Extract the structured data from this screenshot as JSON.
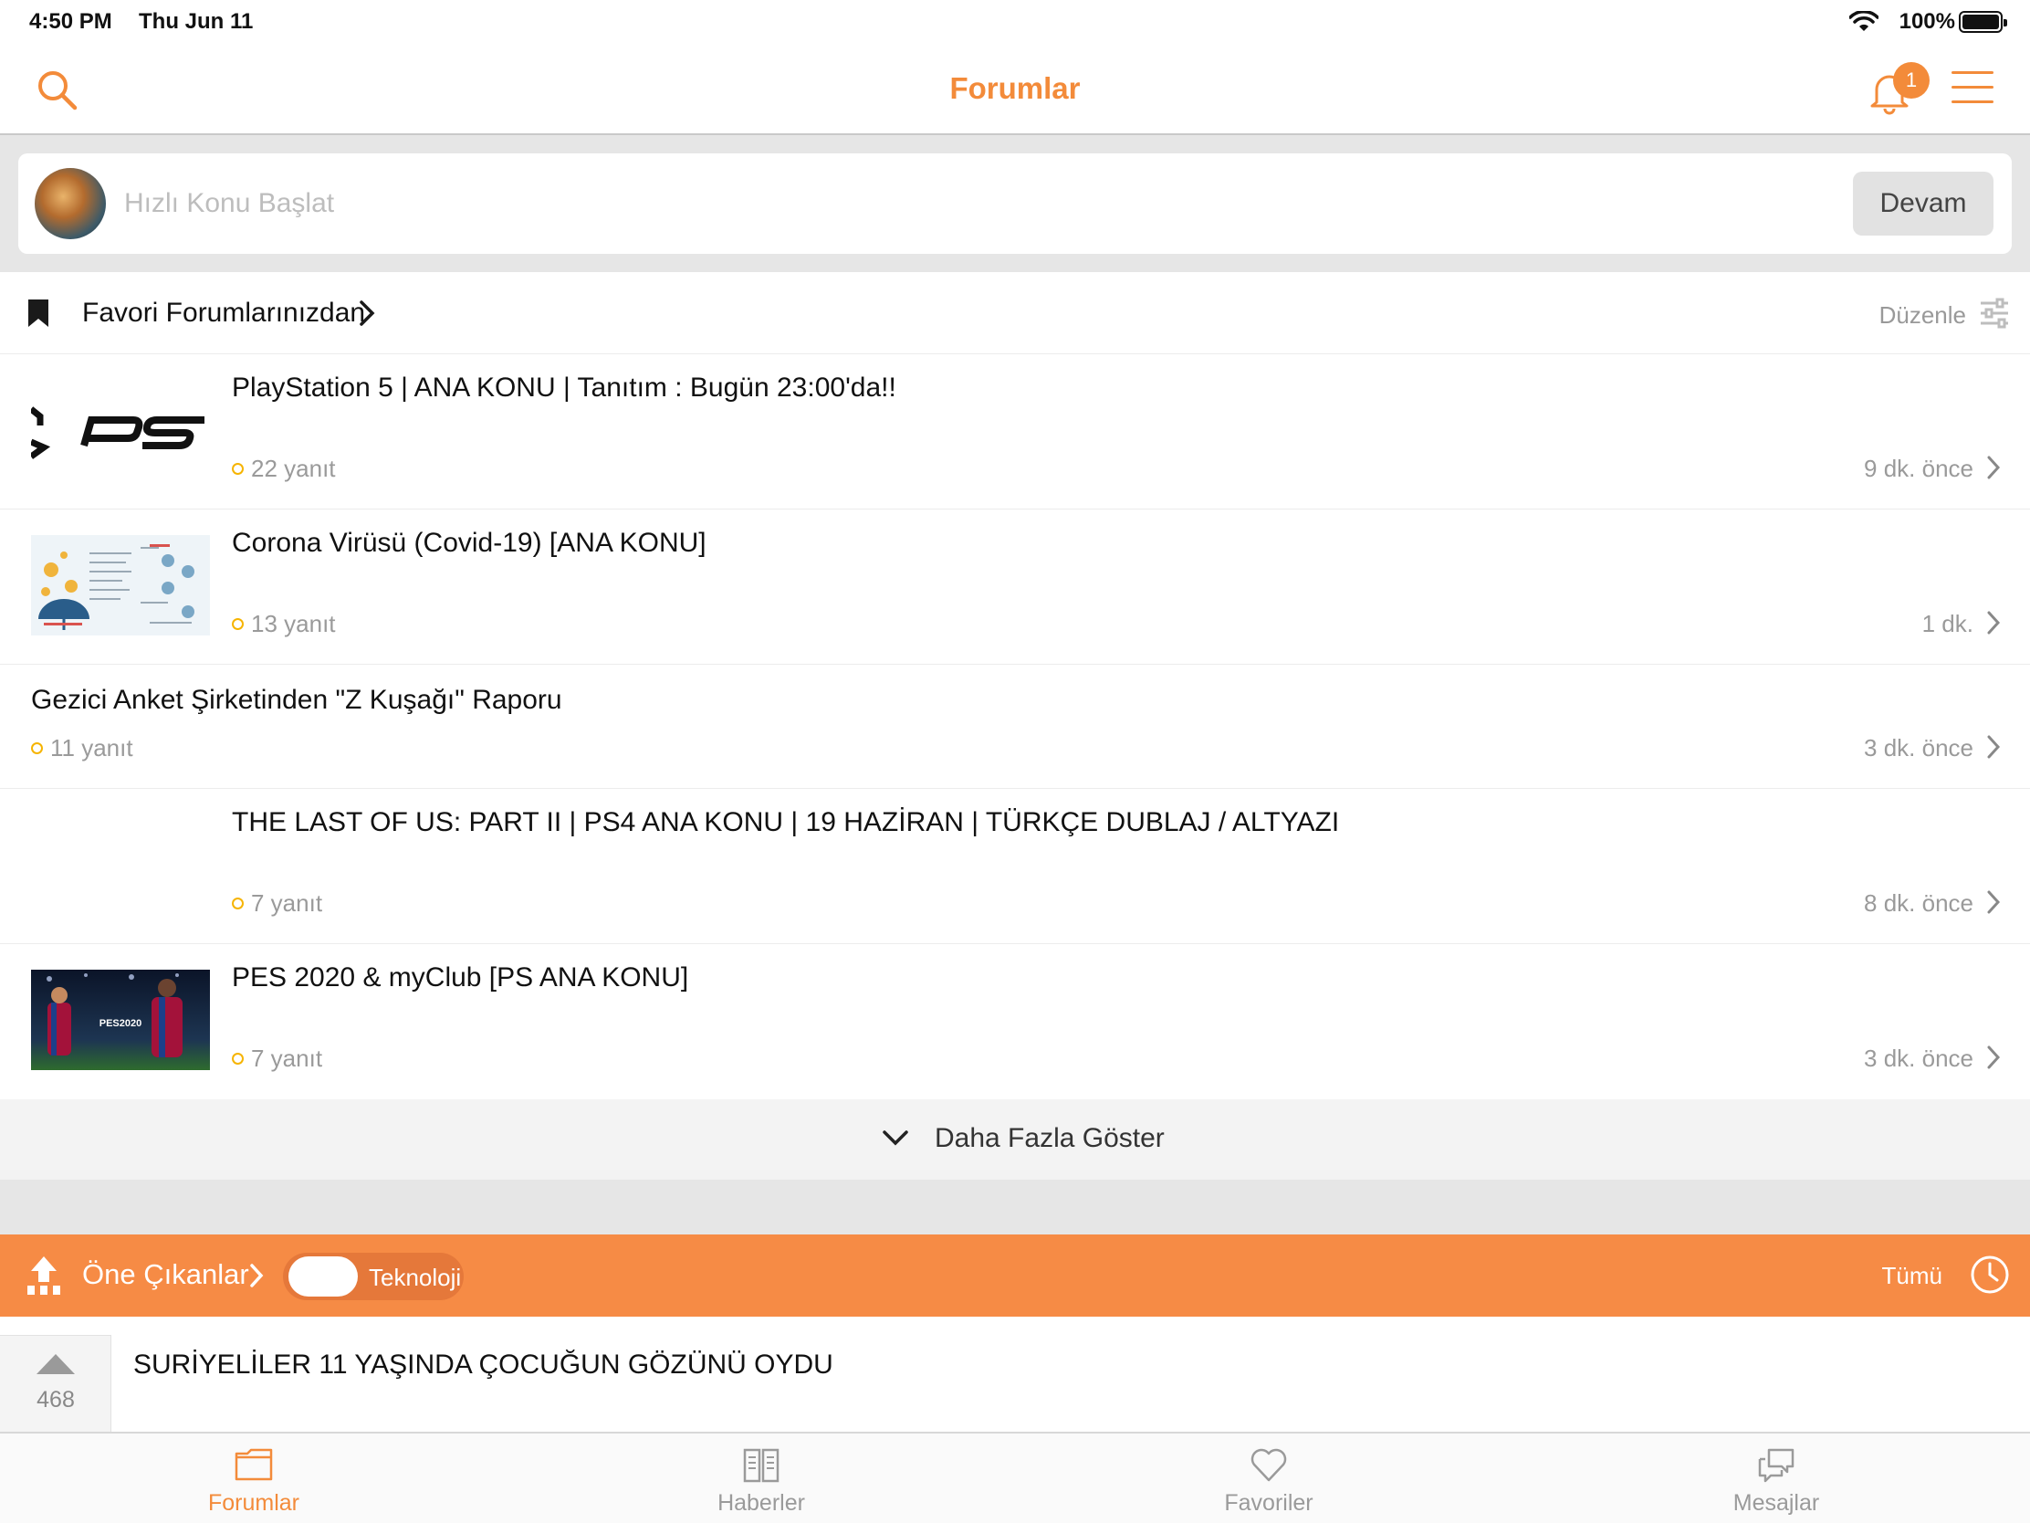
{
  "status_bar": {
    "time": "4:50 PM",
    "date": "Thu Jun 11",
    "battery": "100%"
  },
  "nav": {
    "title": "Forumlar",
    "notification_count": "1"
  },
  "quick_topic": {
    "placeholder": "Hızlı Konu Başlat",
    "button_label": "Devam"
  },
  "favorites": {
    "title": "Favori Forumlarınızdan",
    "edit_label": "Düzenle",
    "topics": [
      {
        "title": "PlayStation 5 | ANA KONU | Tanıtım : Bugün 23:00'da!!",
        "replies": "22 yanıt",
        "time": "9 dk. önce",
        "thumbnail": "ps5-logo"
      },
      {
        "title": "Corona Virüsü (Covid-19) [ANA KONU]",
        "replies": "13 yanıt",
        "time": "1 dk.",
        "thumbnail": "corona-infographic"
      },
      {
        "title": "Gezici Anket Şirketinden \"Z Kuşağı\" Raporu",
        "replies": "11 yanıt",
        "time": "3 dk. önce",
        "thumbnail": ""
      },
      {
        "title": "THE LAST OF US: PART II | PS4 ANA KONU | 19 HAZİRAN | TÜRKÇE DUBLAJ / ALTYAZI",
        "replies": "7 yanıt",
        "time": "8 dk. önce",
        "thumbnail": ""
      },
      {
        "title": "PES 2020 & myClub [PS ANA KONU]",
        "replies": "7 yanıt",
        "time": "3 dk. önce",
        "thumbnail": "pes2020-cover"
      }
    ],
    "more_label": "Daha Fazla Göster"
  },
  "featured": {
    "title": "Öne Çıkanlar",
    "toggle_label": "Teknoloji",
    "all_label": "Tümü",
    "posts": [
      {
        "title": "SURİYELİLER 11 YAŞINDA ÇOCUĞUN GÖZÜNÜ OYDU",
        "votes": "468"
      }
    ]
  },
  "tabs": [
    {
      "label": "Forumlar",
      "icon": "folder-icon",
      "active": true
    },
    {
      "label": "Haberler",
      "icon": "newspaper-icon",
      "active": false
    },
    {
      "label": "Favoriler",
      "icon": "heart-icon",
      "active": false
    },
    {
      "label": "Mesajlar",
      "icon": "chat-icon",
      "active": false
    }
  ],
  "colors": {
    "accent": "#f38b3a",
    "featured_bar": "#f68b45",
    "reply_dot": "#f6b400"
  }
}
